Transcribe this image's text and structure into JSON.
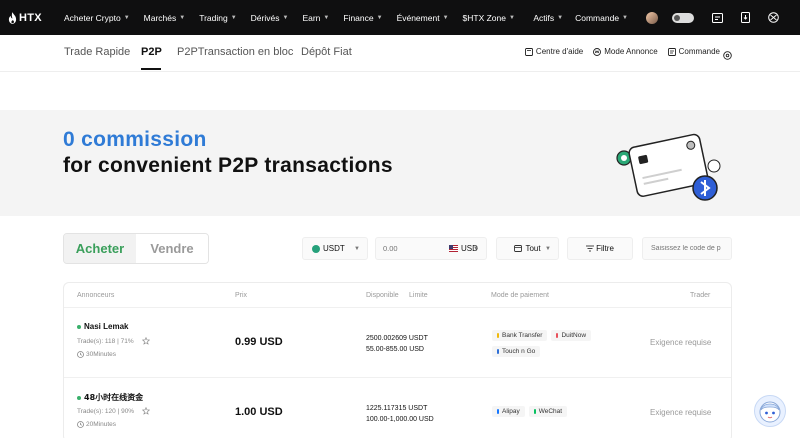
{
  "topnav": {
    "logo_text": "HTX",
    "items": [
      {
        "label": "Acheter Crypto"
      },
      {
        "label": "Marchés"
      },
      {
        "label": "Trading"
      },
      {
        "label": "Dérivés"
      },
      {
        "label": "Earn"
      },
      {
        "label": "Finance"
      },
      {
        "label": "Événement"
      },
      {
        "label": "$HTX Zone"
      }
    ],
    "right": {
      "assets_label": "Actifs",
      "orders_label": "Commande"
    }
  },
  "subtabs": {
    "tabs": [
      {
        "label": "Trade Rapide"
      },
      {
        "label": "P2P"
      },
      {
        "label": "P2PTransaction en bloc"
      },
      {
        "label": "Dépôt Fiat"
      }
    ],
    "help_label": "Centre d'aide",
    "ad_mode_label": "Mode Annonce",
    "order_label": "Commande"
  },
  "banner": {
    "line1": "0 commission",
    "line2": "for convenient P2P transactions"
  },
  "filters": {
    "buy_label": "Acheter",
    "sell_label": "Vendre",
    "coin": "USDT",
    "amount_placeholder": "0.00",
    "fiat": "USD",
    "payment": "Tout",
    "filter_label": "Filtre",
    "search_placeholder": "Saisissez le code de p"
  },
  "table": {
    "headers": {
      "advertiser": "Annonceurs",
      "price": "Prix",
      "available": "Disponible",
      "limit": "Limite",
      "payment": "Mode de paiement",
      "trader": "Trader"
    },
    "rows": [
      {
        "name": "Nasi Lemak",
        "stats": "Trade(s): 118 | 71%",
        "time": "30Minutes",
        "price": "0.99 USD",
        "available": "2500.002609 USDT",
        "limit": "55.00-855.00 USD",
        "payments": [
          {
            "label": "Bank Transfer",
            "color": "#f0b90b"
          },
          {
            "label": "DuitNow",
            "color": "#e8505b"
          },
          {
            "label": "Touch n Go",
            "color": "#2f6fd6"
          }
        ],
        "trader": "Exigence requise"
      },
      {
        "name": "48小时在线资金",
        "stats": "Trade(s): 120 | 90%",
        "time": "20Minutes",
        "price": "1.00 USD",
        "available": "1225.117315 USDT",
        "limit": "100.00-1,000.00 USD",
        "payments": [
          {
            "label": "Alipay",
            "color": "#1677ff"
          },
          {
            "label": "WeChat",
            "color": "#07c160"
          }
        ],
        "trader": "Exigence requise"
      }
    ]
  },
  "colors": {
    "accent_blue": "#2f7bd6",
    "buy_green": "#3a9f5b",
    "nav_bg": "#0f0f10",
    "banner_bg": "#f4f4f4"
  },
  "icons": {
    "logo": "htx-flame-icon",
    "avatar": "user-avatar",
    "toggle": "theme-toggle",
    "download": "download-icon",
    "notification": "message-icon",
    "app": "mobile-app-icon",
    "language": "globe-icon",
    "help": "help-book-icon",
    "ad_mode": "ad-mode-icon",
    "order": "order-icon",
    "settings": "settings-icon",
    "chat": "support-chat-icon"
  }
}
